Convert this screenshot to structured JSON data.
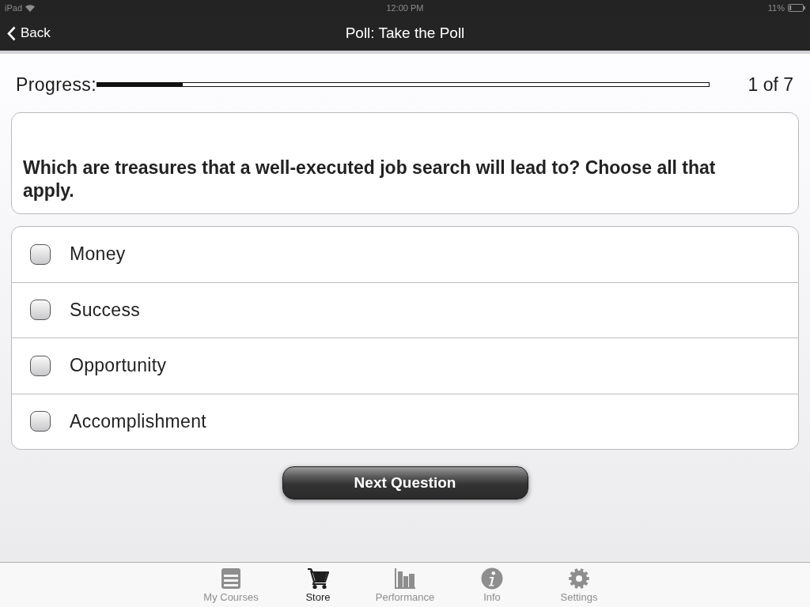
{
  "status_bar": {
    "carrier": "iPad",
    "time": "12:00 PM",
    "battery": "11%"
  },
  "nav_bar": {
    "back": "Back",
    "title": "Poll: Take the Poll"
  },
  "progress": {
    "label": "Progress:",
    "level": 0.14,
    "count": "1 of 7"
  },
  "question": {
    "text": "Which are treasures that a well-executed job search will lead to? Choose all that apply."
  },
  "options": [
    {
      "label": "Money",
      "checked": false
    },
    {
      "label": "Success",
      "checked": false
    },
    {
      "label": "Opportunity",
      "checked": false
    },
    {
      "label": "Accomplishment",
      "checked": false
    }
  ],
  "next_button": {
    "label": "Next Question"
  },
  "tab_bar": [
    {
      "label": "My Courses",
      "kind": "courses",
      "selected": false
    },
    {
      "label": "Store",
      "kind": "store",
      "selected": true
    },
    {
      "label": "Performance",
      "kind": "performance",
      "selected": false
    },
    {
      "label": "Info",
      "kind": "info",
      "selected": false
    },
    {
      "label": "Settings",
      "kind": "settings",
      "selected": false
    }
  ]
}
